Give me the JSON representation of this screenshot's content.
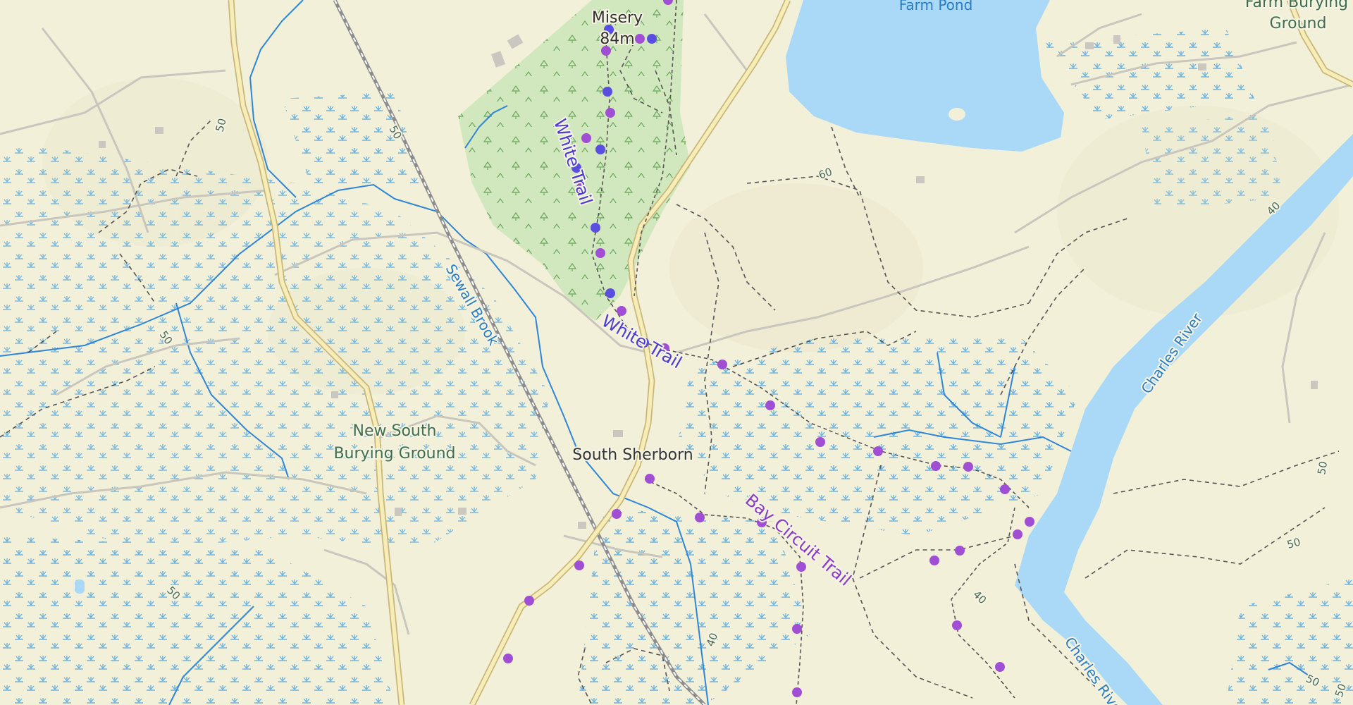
{
  "map": {
    "colors": {
      "land": "#f3f0d9",
      "forest": "#cfe6bc",
      "water": "#a9d9f7",
      "stream": "#2f86d6",
      "marsh": "#5aa8d8",
      "road_fill": "#f7edb8",
      "road_casing": "#c9b77a",
      "minor_road": "#bdbdb6",
      "path": "#555555",
      "rail": "#8d8d8d",
      "white_trail": "#4b3bd1",
      "bay_circuit_trail": "#a04ed4"
    },
    "labels": {
      "misery_name": "Misery",
      "misery_elev": "84m",
      "farm_pond": "Farm Pond",
      "farm_burying_1": "Farm Burying",
      "farm_burying_2": "Ground",
      "white_trail_upper": "White Trail",
      "white_trail_lower": "White Trail",
      "sewall_brook": "Sewall Brook",
      "new_south_1": "New South",
      "new_south_2": "Burying Ground",
      "south_sherborn": "South Sherborn",
      "bay_circuit": "Bay Circuit Trail",
      "charles_river_upper": "Charles River",
      "charles_river_lower": "Charles River"
    },
    "contours": {
      "c50a": "50",
      "c50b": "50",
      "c50c": "50",
      "c50d": "50",
      "c60": "60",
      "c40a": "40",
      "c40b": "40",
      "c40c": "40",
      "c50e": "50",
      "c50f": "50",
      "c50g": "50",
      "c50h": "50"
    },
    "icons": {
      "marsh": "marsh-symbol-icon",
      "tree": "tree-symbol-icon",
      "trail_marker": "trail-waypoint-icon"
    }
  }
}
